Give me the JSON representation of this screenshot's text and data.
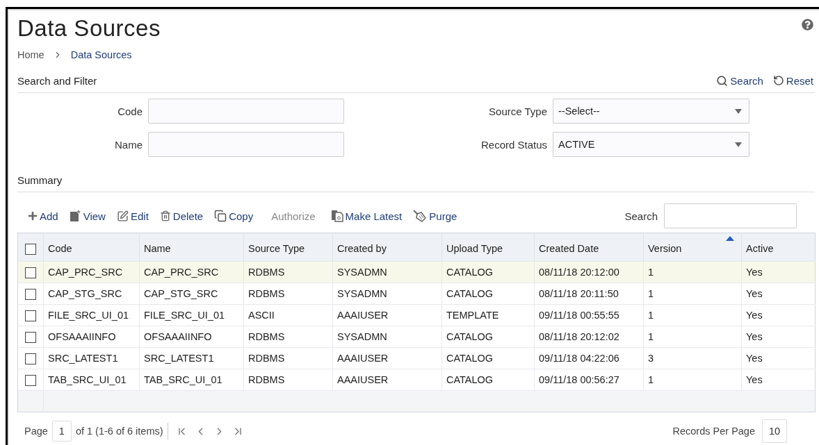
{
  "title": "Data Sources",
  "breadcrumb": [
    {
      "label": "Home",
      "current": false
    },
    {
      "label": "Data Sources",
      "current": true
    }
  ],
  "filter": {
    "title": "Search and Filter",
    "actions": [
      "Search",
      "Reset"
    ],
    "fields": [
      {
        "label": "Code",
        "kind": "text"
      },
      {
        "label": "Source Type",
        "kind": "select",
        "value": "--Select--"
      },
      {
        "label": "Name",
        "kind": "text"
      },
      {
        "label": "Record Status",
        "kind": "select",
        "value": "ACTIVE"
      }
    ]
  },
  "summary": {
    "title": "Summary",
    "toolbar": [
      {
        "label": "Add",
        "disabled": false
      },
      {
        "label": "View",
        "disabled": false
      },
      {
        "label": "Edit",
        "disabled": false
      },
      {
        "label": "Delete",
        "disabled": false
      },
      {
        "label": "Copy",
        "disabled": false
      },
      {
        "label": "Authorize",
        "disabled": true
      },
      {
        "label": "Make Latest",
        "disabled": false
      },
      {
        "label": "Purge",
        "disabled": false
      }
    ],
    "search_label": "Search",
    "table": {
      "all_checked": false,
      "columns": [
        {
          "label": "Code",
          "sorted": false
        },
        {
          "label": "Name",
          "sorted": false
        },
        {
          "label": "Source Type",
          "sorted": false
        },
        {
          "label": "Created by",
          "sorted": false
        },
        {
          "label": "Upload Type",
          "sorted": false
        },
        {
          "label": "Created Date",
          "sorted": false
        },
        {
          "label": "Version",
          "sorted": true
        },
        {
          "label": "Active",
          "sorted": false
        }
      ],
      "rows": [
        {
          "selected": true,
          "checked": false,
          "cells": [
            "CAP_PRC_SRC",
            "CAP_PRC_SRC",
            "RDBMS",
            "SYSADMN",
            "CATALOG",
            "08/11/18 20:12:00",
            "1",
            "Yes"
          ]
        },
        {
          "selected": false,
          "checked": false,
          "cells": [
            "CAP_STG_SRC",
            "CAP_STG_SRC",
            "RDBMS",
            "SYSADMN",
            "CATALOG",
            "08/11/18 20:11:50",
            "1",
            "Yes"
          ]
        },
        {
          "selected": false,
          "checked": false,
          "cells": [
            "FILE_SRC_UI_01",
            "FILE_SRC_UI_01",
            "ASCII",
            "AAAIUSER",
            "TEMPLATE",
            "09/11/18 00:55:55",
            "1",
            "Yes"
          ]
        },
        {
          "selected": false,
          "checked": false,
          "cells": [
            "OFSAAAIINFO",
            "OFSAAAIINFO",
            "RDBMS",
            "SYSADMN",
            "CATALOG",
            "08/11/18 20:12:02",
            "1",
            "Yes"
          ]
        },
        {
          "selected": false,
          "checked": false,
          "cells": [
            "SRC_LATEST1",
            "SRC_LATEST1",
            "RDBMS",
            "AAAIUSER",
            "CATALOG",
            "09/11/18 04:22:06",
            "3",
            "Yes"
          ]
        },
        {
          "selected": false,
          "checked": false,
          "cells": [
            "TAB_SRC_UI_01",
            "TAB_SRC_UI_01",
            "RDBMS",
            "AAAIUSER",
            "CATALOG",
            "09/11/18 00:56:27",
            "1",
            "Yes"
          ]
        }
      ]
    },
    "pagination": {
      "page_label": "Page",
      "page": "1",
      "summary": "of 1 (1-6 of 6 items)",
      "per_page_label": "Records Per Page",
      "per_page": "10"
    }
  }
}
